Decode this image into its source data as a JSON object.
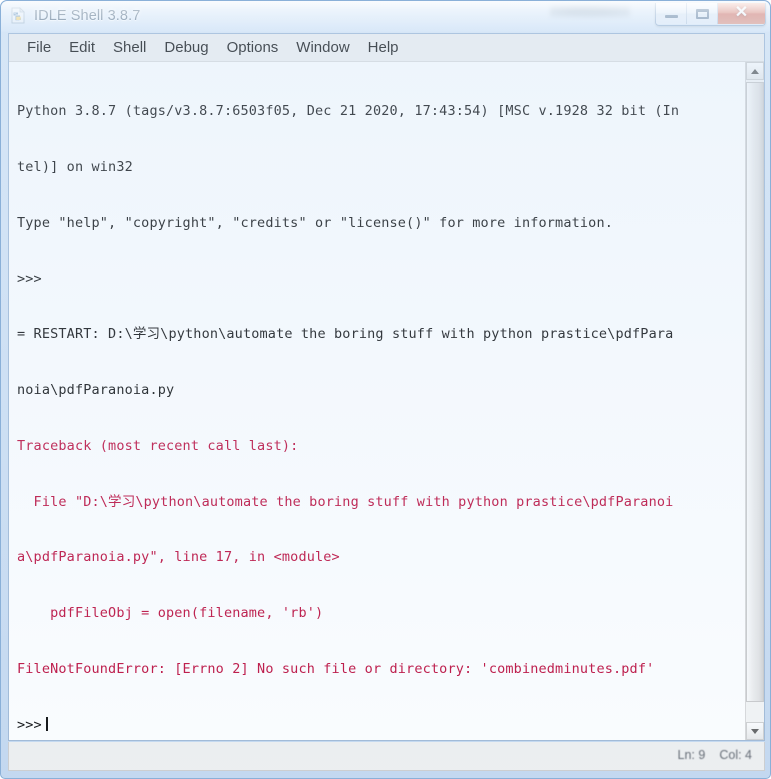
{
  "window": {
    "title": "IDLE Shell 3.8.7",
    "icon": "python-file-icon",
    "controls": {
      "minimize": "minimize-button",
      "maximize": "maximize-button",
      "close_glyph": "✕"
    }
  },
  "menubar": {
    "items": [
      {
        "label": "File"
      },
      {
        "label": "Edit"
      },
      {
        "label": "Shell"
      },
      {
        "label": "Debug"
      },
      {
        "label": "Options"
      },
      {
        "label": "Window"
      },
      {
        "label": "Help"
      }
    ]
  },
  "shell": {
    "colors": {
      "normal_text": "#000000",
      "error_text": "#bb0033",
      "background": "#ffffff"
    },
    "lines": [
      {
        "kind": "normal",
        "text": "Python 3.8.7 (tags/v3.8.7:6503f05, Dec 21 2020, 17:43:54) [MSC v.1928 32 bit (In"
      },
      {
        "kind": "normal",
        "text": "tel)] on win32"
      },
      {
        "kind": "normal",
        "text": "Type \"help\", \"copyright\", \"credits\" or \"license()\" for more information."
      },
      {
        "kind": "prompt",
        "text": ">>>"
      },
      {
        "kind": "normal",
        "text": "= RESTART: D:\\学习\\python\\automate the boring stuff with python prastice\\pdfPara"
      },
      {
        "kind": "normal",
        "text": "noia\\pdfParanoia.py"
      },
      {
        "kind": "error",
        "text": "Traceback (most recent call last):"
      },
      {
        "kind": "error",
        "text": "  File \"D:\\学习\\python\\automate the boring stuff with python prastice\\pdfParanoi"
      },
      {
        "kind": "error",
        "text": "a\\pdfParanoia.py\", line 17, in <module>"
      },
      {
        "kind": "error",
        "text": "    pdfFileObj = open(filename, 'rb')"
      },
      {
        "kind": "error",
        "text": "FileNotFoundError: [Errno 2] No such file or directory: 'combinedminutes.pdf'"
      },
      {
        "kind": "prompt_caret",
        "text": ">>>"
      }
    ]
  },
  "scrollbar": {
    "up_arrow": "scroll-up-arrow",
    "down_arrow": "scroll-down-arrow"
  },
  "statusbar": {
    "line_label": "Ln: 9",
    "col_label": "Col: 4"
  }
}
